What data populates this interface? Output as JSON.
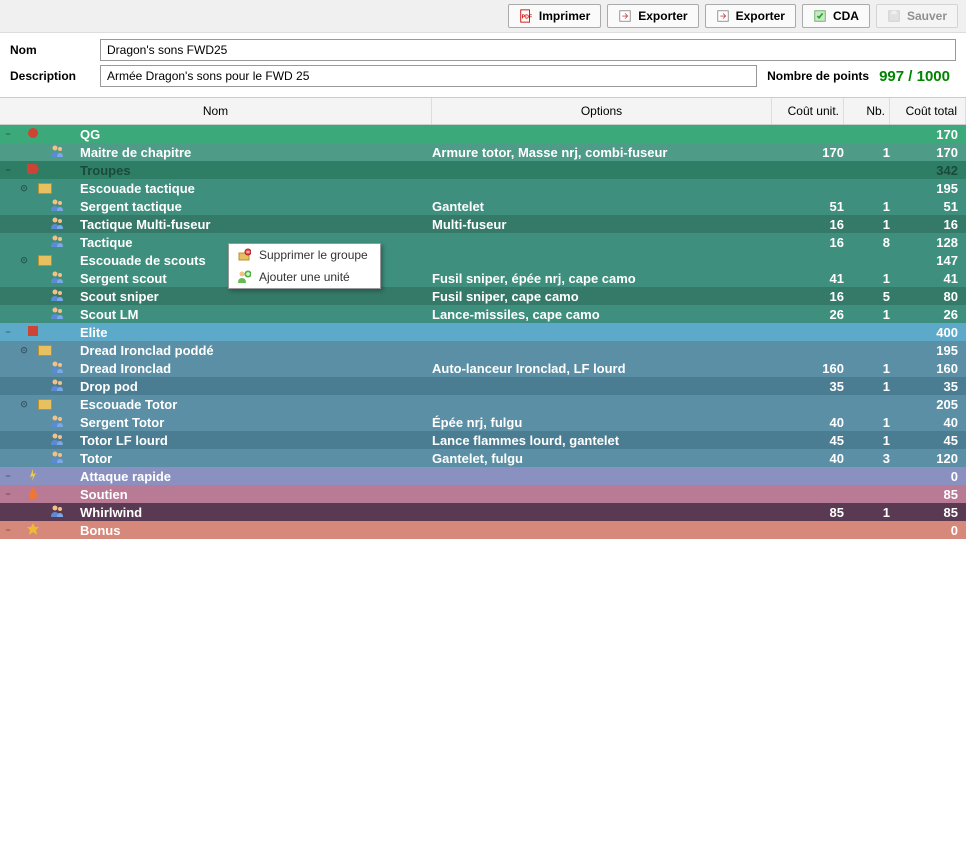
{
  "toolbar": {
    "print": "Imprimer",
    "export1": "Exporter",
    "export2": "Exporter",
    "cda": "CDA",
    "save": "Sauver"
  },
  "form": {
    "name_label": "Nom",
    "name_value": "Dragon's sons FWD25",
    "desc_label": "Description",
    "desc_value": "Armée Dragon's sons pour le FWD 25",
    "points_label": "Nombre de points",
    "points_value": "997 / 1000"
  },
  "headers": {
    "name": "Nom",
    "options": "Options",
    "unit_cost": "Coût unit.",
    "nb": "Nb.",
    "total": "Coût total"
  },
  "context_menu": {
    "delete_group": "Supprimer le groupe",
    "add_unit": "Ajouter une unité"
  },
  "rows": [
    {
      "type": "cat",
      "cls": "cat-qg",
      "name": "QG",
      "total": "170"
    },
    {
      "type": "unit",
      "cls": "unit-qg",
      "name": "Maitre de chapitre",
      "opts": "Armure totor, Masse nrj, combi-fuseur",
      "unit": "170",
      "nb": "1",
      "total": "170"
    },
    {
      "type": "cat",
      "cls": "cat-troupes",
      "name": "Troupes",
      "total": "342"
    },
    {
      "type": "grp",
      "cls": "grp-troupes",
      "name": "Escouade tactique",
      "total": "195"
    },
    {
      "type": "unit",
      "cls": "unit-troupes-a",
      "name": "Sergent tactique",
      "opts": "Gantelet",
      "unit": "51",
      "nb": "1",
      "total": "51"
    },
    {
      "type": "unit",
      "cls": "unit-troupes-b",
      "name": "Tactique Multi-fuseur",
      "opts": "Multi-fuseur",
      "unit": "16",
      "nb": "1",
      "total": "16"
    },
    {
      "type": "unit",
      "cls": "unit-troupes-a",
      "name": "Tactique",
      "opts": "",
      "unit": "16",
      "nb": "8",
      "total": "128"
    },
    {
      "type": "grp",
      "cls": "grp-troupes",
      "name": "Escouade de scouts",
      "total": "147",
      "menu": true
    },
    {
      "type": "unit",
      "cls": "unit-troupes-a",
      "name": "Sergent scout",
      "opts": "Fusil sniper, épée nrj, cape camo",
      "unit": "41",
      "nb": "1",
      "total": "41"
    },
    {
      "type": "unit",
      "cls": "unit-troupes-b",
      "name": "Scout sniper",
      "opts": "Fusil sniper, cape camo",
      "unit": "16",
      "nb": "5",
      "total": "80"
    },
    {
      "type": "unit",
      "cls": "unit-troupes-a",
      "name": "Scout LM",
      "opts": "Lance-missiles, cape camo",
      "unit": "26",
      "nb": "1",
      "total": "26"
    },
    {
      "type": "cat",
      "cls": "cat-elite",
      "name": "Elite",
      "total": "400"
    },
    {
      "type": "grp",
      "cls": "grp-elite",
      "name": "Dread Ironclad poddé",
      "total": "195"
    },
    {
      "type": "unit",
      "cls": "unit-elite-a",
      "name": "Dread Ironclad",
      "opts": "Auto-lanceur Ironclad, LF lourd",
      "unit": "160",
      "nb": "1",
      "total": "160"
    },
    {
      "type": "unit",
      "cls": "unit-elite-b",
      "name": "Drop pod",
      "opts": "",
      "unit": "35",
      "nb": "1",
      "total": "35"
    },
    {
      "type": "grp",
      "cls": "grp-elite",
      "name": "Escouade Totor",
      "total": "205"
    },
    {
      "type": "unit",
      "cls": "unit-elite-a",
      "name": "Sergent Totor",
      "opts": "Épée nrj, fulgu",
      "unit": "40",
      "nb": "1",
      "total": "40"
    },
    {
      "type": "unit",
      "cls": "unit-elite-b",
      "name": "Totor LF lourd",
      "opts": "Lance flammes lourd, gantelet",
      "unit": "45",
      "nb": "1",
      "total": "45"
    },
    {
      "type": "unit",
      "cls": "unit-elite-a",
      "name": "Totor",
      "opts": "Gantelet, fulgu",
      "unit": "40",
      "nb": "3",
      "total": "120"
    },
    {
      "type": "cat",
      "cls": "cat-rapide",
      "name": "Attaque rapide",
      "total": "0"
    },
    {
      "type": "cat",
      "cls": "cat-soutien",
      "name": "Soutien",
      "total": "85"
    },
    {
      "type": "unit",
      "cls": "grp-soutien",
      "name": "Whirlwind",
      "opts": "",
      "unit": "85",
      "nb": "1",
      "total": "85"
    },
    {
      "type": "cat",
      "cls": "cat-bonus",
      "name": "Bonus",
      "total": "0"
    }
  ]
}
